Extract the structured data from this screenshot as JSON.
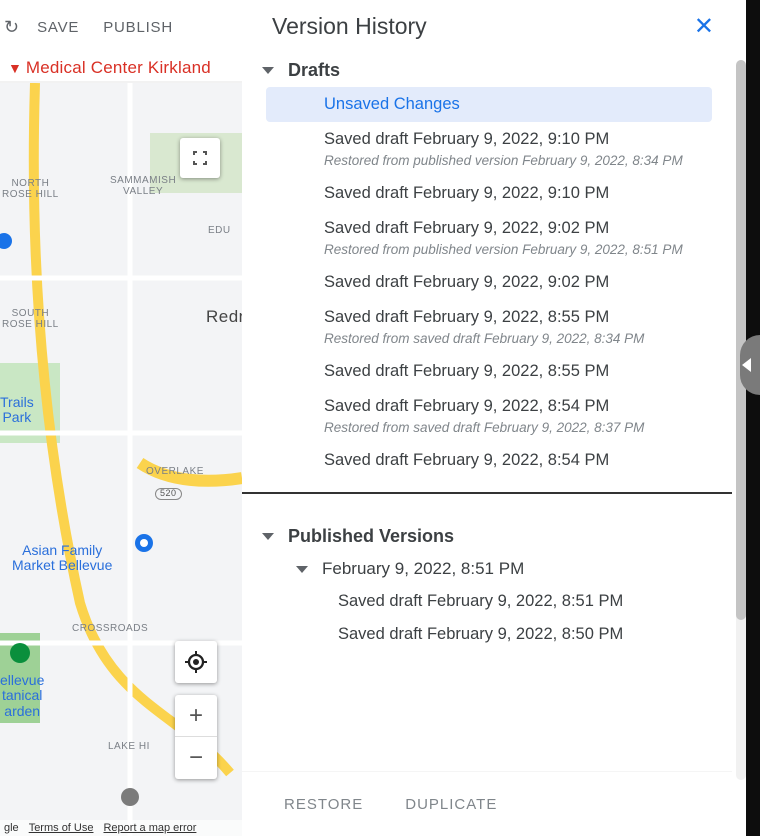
{
  "toolbar": {
    "save_label": "SAVE",
    "publish_label": "PUBLISH"
  },
  "place": {
    "title": "Medical Center Kirkland"
  },
  "map": {
    "labels": {
      "nrh": "NORTH\nROSE HILL",
      "sv": "SAMMAMISH\nVALLEY",
      "edu": "EDU",
      "redn": "Redn",
      "srh": "SOUTH\nROSE HILL",
      "trails": "Trails\nPark",
      "overlake": "OVERLAKE",
      "badge520": "520",
      "afmb": "Asian Family\nMarket Bellevue",
      "crossroads": "CROSSROADS",
      "bvbg": "ellevue\ntanical\narden",
      "lakehi": "LAKE HI"
    },
    "footer": {
      "gle": "gle",
      "tou": "Terms of Use",
      "err": "Report a map error"
    }
  },
  "vh": {
    "title": "Version History",
    "drafts_label": "Drafts",
    "published_label": "Published Versions",
    "footer": {
      "restore": "RESTORE",
      "duplicate": "DUPLICATE"
    },
    "items": [
      {
        "text": "Unsaved Changes",
        "selected": true
      },
      {
        "text": "Saved draft February 9, 2022, 9:10 PM",
        "note": "Restored from published version February 9, 2022, 8:34 PM"
      },
      {
        "text": "Saved draft February 9, 2022, 9:10 PM"
      },
      {
        "text": "Saved draft February 9, 2022, 9:02 PM",
        "note": "Restored from published version February 9, 2022, 8:51 PM"
      },
      {
        "text": "Saved draft February 9, 2022, 9:02 PM"
      },
      {
        "text": "Saved draft February 9, 2022, 8:55 PM",
        "note": "Restored from saved draft February 9, 2022, 8:34 PM"
      },
      {
        "text": "Saved draft February 9, 2022, 8:55 PM"
      },
      {
        "text": "Saved draft February 9, 2022, 8:54 PM",
        "note": "Restored from saved draft February 9, 2022, 8:37 PM"
      },
      {
        "text": "Saved draft February 9, 2022, 8:54 PM"
      }
    ],
    "published": {
      "group_date": "February 9, 2022, 8:51 PM",
      "sub_items": [
        "Saved draft February 9, 2022, 8:51 PM",
        "Saved draft February 9, 2022, 8:50 PM"
      ]
    }
  }
}
